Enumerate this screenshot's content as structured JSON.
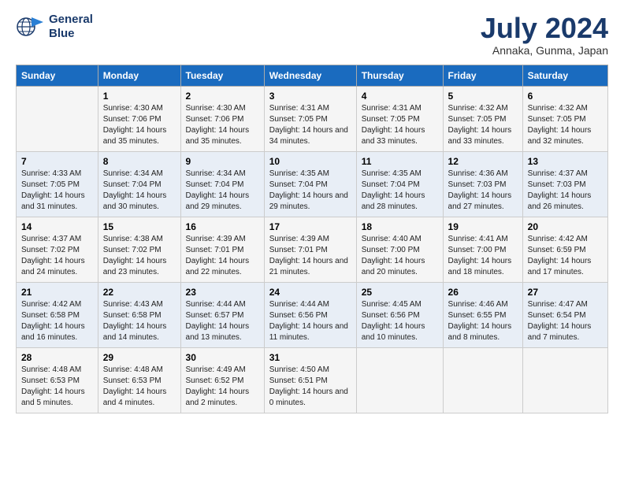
{
  "logo": {
    "line1": "General",
    "line2": "Blue"
  },
  "title": "July 2024",
  "subtitle": "Annaka, Gunma, Japan",
  "header": {
    "accent_color": "#1a6bbf"
  },
  "weekdays": [
    "Sunday",
    "Monday",
    "Tuesday",
    "Wednesday",
    "Thursday",
    "Friday",
    "Saturday"
  ],
  "weeks": [
    [
      {
        "day": "",
        "sunrise": "",
        "sunset": "",
        "daylight": ""
      },
      {
        "day": "1",
        "sunrise": "4:30 AM",
        "sunset": "7:06 PM",
        "daylight": "14 hours and 35 minutes."
      },
      {
        "day": "2",
        "sunrise": "4:30 AM",
        "sunset": "7:06 PM",
        "daylight": "14 hours and 35 minutes."
      },
      {
        "day": "3",
        "sunrise": "4:31 AM",
        "sunset": "7:05 PM",
        "daylight": "14 hours and 34 minutes."
      },
      {
        "day": "4",
        "sunrise": "4:31 AM",
        "sunset": "7:05 PM",
        "daylight": "14 hours and 33 minutes."
      },
      {
        "day": "5",
        "sunrise": "4:32 AM",
        "sunset": "7:05 PM",
        "daylight": "14 hours and 33 minutes."
      },
      {
        "day": "6",
        "sunrise": "4:32 AM",
        "sunset": "7:05 PM",
        "daylight": "14 hours and 32 minutes."
      }
    ],
    [
      {
        "day": "7",
        "sunrise": "4:33 AM",
        "sunset": "7:05 PM",
        "daylight": "14 hours and 31 minutes."
      },
      {
        "day": "8",
        "sunrise": "4:34 AM",
        "sunset": "7:04 PM",
        "daylight": "14 hours and 30 minutes."
      },
      {
        "day": "9",
        "sunrise": "4:34 AM",
        "sunset": "7:04 PM",
        "daylight": "14 hours and 29 minutes."
      },
      {
        "day": "10",
        "sunrise": "4:35 AM",
        "sunset": "7:04 PM",
        "daylight": "14 hours and 29 minutes."
      },
      {
        "day": "11",
        "sunrise": "4:35 AM",
        "sunset": "7:04 PM",
        "daylight": "14 hours and 28 minutes."
      },
      {
        "day": "12",
        "sunrise": "4:36 AM",
        "sunset": "7:03 PM",
        "daylight": "14 hours and 27 minutes."
      },
      {
        "day": "13",
        "sunrise": "4:37 AM",
        "sunset": "7:03 PM",
        "daylight": "14 hours and 26 minutes."
      }
    ],
    [
      {
        "day": "14",
        "sunrise": "4:37 AM",
        "sunset": "7:02 PM",
        "daylight": "14 hours and 24 minutes."
      },
      {
        "day": "15",
        "sunrise": "4:38 AM",
        "sunset": "7:02 PM",
        "daylight": "14 hours and 23 minutes."
      },
      {
        "day": "16",
        "sunrise": "4:39 AM",
        "sunset": "7:01 PM",
        "daylight": "14 hours and 22 minutes."
      },
      {
        "day": "17",
        "sunrise": "4:39 AM",
        "sunset": "7:01 PM",
        "daylight": "14 hours and 21 minutes."
      },
      {
        "day": "18",
        "sunrise": "4:40 AM",
        "sunset": "7:00 PM",
        "daylight": "14 hours and 20 minutes."
      },
      {
        "day": "19",
        "sunrise": "4:41 AM",
        "sunset": "7:00 PM",
        "daylight": "14 hours and 18 minutes."
      },
      {
        "day": "20",
        "sunrise": "4:42 AM",
        "sunset": "6:59 PM",
        "daylight": "14 hours and 17 minutes."
      }
    ],
    [
      {
        "day": "21",
        "sunrise": "4:42 AM",
        "sunset": "6:58 PM",
        "daylight": "14 hours and 16 minutes."
      },
      {
        "day": "22",
        "sunrise": "4:43 AM",
        "sunset": "6:58 PM",
        "daylight": "14 hours and 14 minutes."
      },
      {
        "day": "23",
        "sunrise": "4:44 AM",
        "sunset": "6:57 PM",
        "daylight": "14 hours and 13 minutes."
      },
      {
        "day": "24",
        "sunrise": "4:44 AM",
        "sunset": "6:56 PM",
        "daylight": "14 hours and 11 minutes."
      },
      {
        "day": "25",
        "sunrise": "4:45 AM",
        "sunset": "6:56 PM",
        "daylight": "14 hours and 10 minutes."
      },
      {
        "day": "26",
        "sunrise": "4:46 AM",
        "sunset": "6:55 PM",
        "daylight": "14 hours and 8 minutes."
      },
      {
        "day": "27",
        "sunrise": "4:47 AM",
        "sunset": "6:54 PM",
        "daylight": "14 hours and 7 minutes."
      }
    ],
    [
      {
        "day": "28",
        "sunrise": "4:48 AM",
        "sunset": "6:53 PM",
        "daylight": "14 hours and 5 minutes."
      },
      {
        "day": "29",
        "sunrise": "4:48 AM",
        "sunset": "6:53 PM",
        "daylight": "14 hours and 4 minutes."
      },
      {
        "day": "30",
        "sunrise": "4:49 AM",
        "sunset": "6:52 PM",
        "daylight": "14 hours and 2 minutes."
      },
      {
        "day": "31",
        "sunrise": "4:50 AM",
        "sunset": "6:51 PM",
        "daylight": "14 hours and 0 minutes."
      },
      {
        "day": "",
        "sunrise": "",
        "sunset": "",
        "daylight": ""
      },
      {
        "day": "",
        "sunrise": "",
        "sunset": "",
        "daylight": ""
      },
      {
        "day": "",
        "sunrise": "",
        "sunset": "",
        "daylight": ""
      }
    ]
  ]
}
